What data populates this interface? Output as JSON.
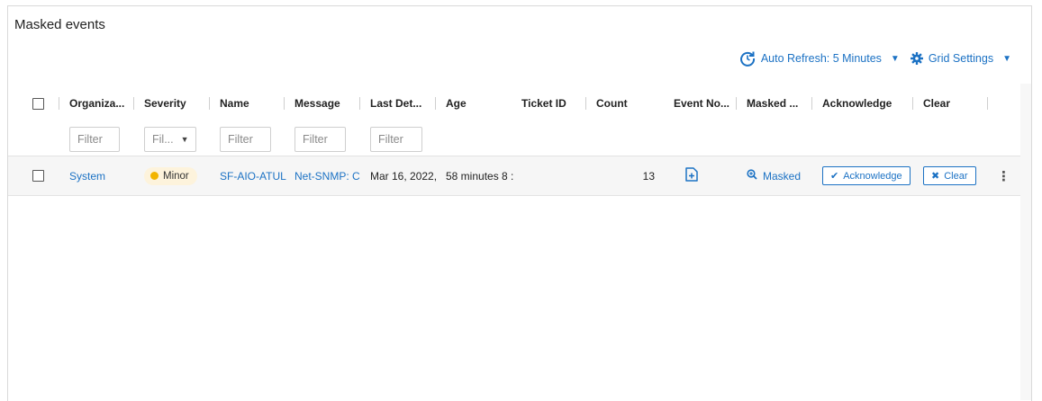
{
  "panel": {
    "title": "Masked events"
  },
  "toolbar": {
    "auto_refresh_label": "Auto Refresh: 5 Minutes",
    "grid_settings_label": "Grid Settings"
  },
  "columns": [
    {
      "key": "organization",
      "label": "Organiza..."
    },
    {
      "key": "severity",
      "label": "Severity"
    },
    {
      "key": "name",
      "label": "Name"
    },
    {
      "key": "message",
      "label": "Message"
    },
    {
      "key": "last_detected",
      "label": "Last Det..."
    },
    {
      "key": "age",
      "label": "Age"
    },
    {
      "key": "ticket_id",
      "label": "Ticket ID"
    },
    {
      "key": "count",
      "label": "Count"
    },
    {
      "key": "event_notes",
      "label": "Event No..."
    },
    {
      "key": "masked",
      "label": "Masked ..."
    },
    {
      "key": "acknowledge",
      "label": "Acknowledge"
    },
    {
      "key": "clear",
      "label": "Clear"
    }
  ],
  "filters": {
    "placeholder": "Filter",
    "severity_placeholder": "Fil..."
  },
  "rows": [
    {
      "organization": "System",
      "severity": "Minor",
      "severity_color": "#f2b400",
      "name": "SF-AIO-ATUL",
      "message": "Net-SNMP: C",
      "last_detected": "Mar 16, 2022,",
      "age": "58 minutes 8 :",
      "ticket_id": "",
      "count": "13",
      "masked_label": "Masked",
      "acknowledge_label": "Acknowledge",
      "clear_label": "Clear"
    }
  ],
  "colors": {
    "accent": "#1c72c4",
    "row_bg": "#f6f6f6"
  }
}
